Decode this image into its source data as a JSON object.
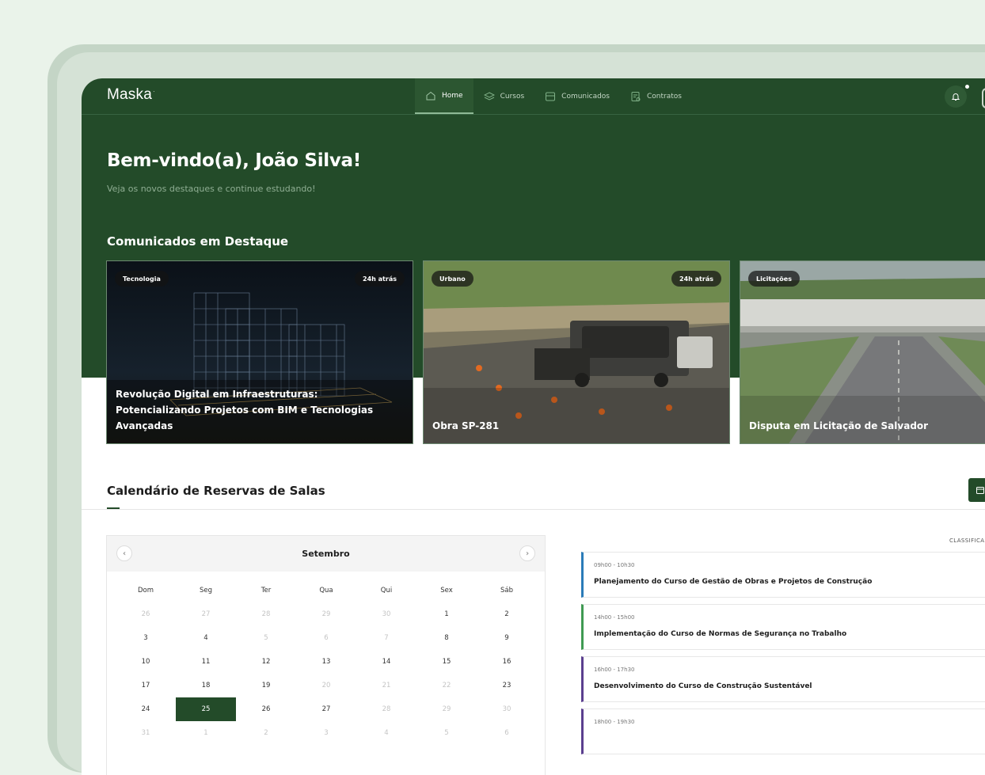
{
  "app": {
    "logo": "Maska",
    "logo_mark": "·"
  },
  "nav": {
    "items": [
      {
        "label": "Home",
        "icon": "home-icon",
        "active": true
      },
      {
        "label": "Cursos",
        "icon": "layers-icon",
        "active": false
      },
      {
        "label": "Comunicados",
        "icon": "inbox-icon",
        "active": false
      },
      {
        "label": "Contratos",
        "icon": "document-icon",
        "active": false
      }
    ]
  },
  "hero": {
    "title": "Bem-vindo(a), João Silva!",
    "subtitle": "Veja os novos destaques e continue estudando!"
  },
  "featured": {
    "title": "Comunicados em Destaque",
    "cards": [
      {
        "tag": "Tecnologia",
        "time": "24h atrás",
        "title": "Revolução Digital em Infraestruturas: Potencializando Projetos com BIM e Tecnologias Avançadas"
      },
      {
        "tag": "Urbano",
        "time": "24h atrás",
        "title": "Obra SP-281"
      },
      {
        "tag": "Licitações",
        "time": "",
        "title": "Disputa em Licitação de Salvador"
      }
    ]
  },
  "calendar": {
    "title": "Calendário de Reservas de Salas",
    "month": "Setembro",
    "weekdays": [
      "Dom",
      "Seg",
      "Ter",
      "Qua",
      "Qui",
      "Sex",
      "Sáb"
    ],
    "selected_day": "25",
    "days": [
      {
        "d": "26",
        "m": true
      },
      {
        "d": "27",
        "m": true
      },
      {
        "d": "28",
        "m": true
      },
      {
        "d": "29",
        "m": true
      },
      {
        "d": "30",
        "m": true
      },
      {
        "d": "1",
        "m": false
      },
      {
        "d": "2",
        "m": false
      },
      {
        "d": "3",
        "m": false
      },
      {
        "d": "4",
        "m": false
      },
      {
        "d": "5",
        "m": true
      },
      {
        "d": "6",
        "m": true
      },
      {
        "d": "7",
        "m": true
      },
      {
        "d": "8",
        "m": false
      },
      {
        "d": "9",
        "m": false
      },
      {
        "d": "10",
        "m": false
      },
      {
        "d": "11",
        "m": false
      },
      {
        "d": "12",
        "m": false
      },
      {
        "d": "13",
        "m": false
      },
      {
        "d": "14",
        "m": false
      },
      {
        "d": "15",
        "m": false
      },
      {
        "d": "16",
        "m": false
      },
      {
        "d": "17",
        "m": false
      },
      {
        "d": "18",
        "m": false
      },
      {
        "d": "19",
        "m": false
      },
      {
        "d": "20",
        "m": true
      },
      {
        "d": "21",
        "m": true
      },
      {
        "d": "22",
        "m": true
      },
      {
        "d": "23",
        "m": false
      },
      {
        "d": "24",
        "m": false
      },
      {
        "d": "25",
        "m": false
      },
      {
        "d": "26",
        "m": false
      },
      {
        "d": "27",
        "m": false
      },
      {
        "d": "28",
        "m": true
      },
      {
        "d": "29",
        "m": true
      },
      {
        "d": "30",
        "m": true
      },
      {
        "d": "31",
        "m": true
      },
      {
        "d": "1",
        "m": true
      },
      {
        "d": "2",
        "m": true
      },
      {
        "d": "3",
        "m": true
      },
      {
        "d": "4",
        "m": true
      },
      {
        "d": "5",
        "m": true
      },
      {
        "d": "6",
        "m": true
      }
    ]
  },
  "schedule": {
    "label": "CLASSIFICA",
    "events": [
      {
        "time": "09h00 - 10h30",
        "title": "Planejamento do Curso de Gestão de Obras e Projetos de Construção",
        "color": "#2a7bb8"
      },
      {
        "time": "14h00 - 15h00",
        "title": "Implementação do Curso de Normas de Segurança no Trabalho",
        "color": "#3f9a52"
      },
      {
        "time": "16h00 - 17h30",
        "title": "Desenvolvimento do Curso de Construção Sustentável",
        "color": "#5b3f8f"
      },
      {
        "time": "18h00 - 19h30",
        "title": "",
        "color": "#5b3f8f"
      }
    ]
  },
  "colors": {
    "brand": "#234b29",
    "accent": "#8fb996"
  }
}
